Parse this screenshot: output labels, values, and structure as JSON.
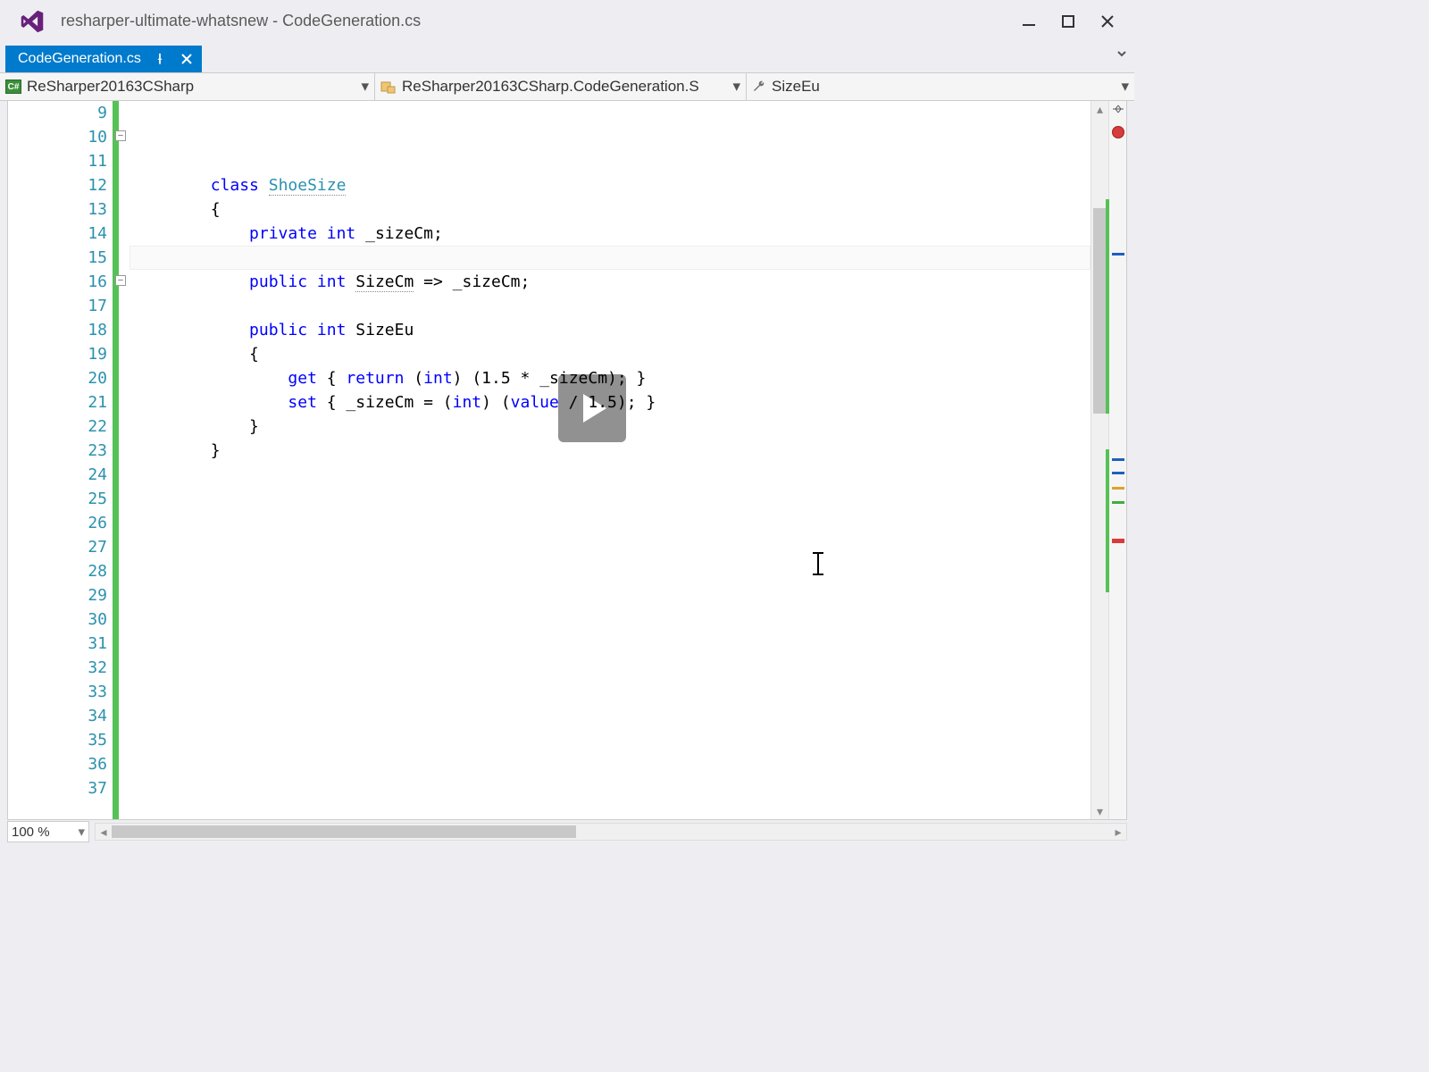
{
  "title": "resharper-ultimate-whatsnew - CodeGeneration.cs",
  "tab": {
    "label": "CodeGeneration.cs"
  },
  "nav": {
    "project": "ReSharper20163CSharp",
    "type": "ReSharper20163CSharp.CodeGeneration.S",
    "member": "SizeEu"
  },
  "zoom": "100 %",
  "gutter": {
    "start": 9,
    "end": 37
  },
  "code": {
    "l9": "",
    "l10": {
      "kw": "class",
      "name": "ShoeSize"
    },
    "l11": "        {",
    "l12": {
      "pre": "            ",
      "kw1": "private",
      "kw2": "int",
      "id": "_sizeCm",
      "post": ";"
    },
    "l13": "",
    "l14": {
      "pre": "            ",
      "kw1": "public",
      "kw2": "int",
      "id": "SizeCm",
      "arrow": " => _sizeCm;"
    },
    "l15": "",
    "l16": {
      "pre": "            ",
      "kw1": "public",
      "kw2": "int",
      "id": "SizeEu"
    },
    "l17": "            {",
    "l18": {
      "pre": "                ",
      "kw": "get",
      "open": " { ",
      "ret": "return",
      "sp": " (",
      "cast": "int",
      "rest": ") (1.5 * _sizeCm); }"
    },
    "l19": {
      "pre": "                ",
      "kw": "set",
      "open": " { _sizeCm = (",
      "cast": "int",
      "mid": ") (",
      "val": "value",
      "rest": " / 1.5); }"
    },
    "l20": "            }",
    "l21": "        }",
    "l22": "",
    "l23": "",
    "l24": "",
    "l25": "",
    "l26": "",
    "l27": "",
    "l28": "",
    "l29": "",
    "l30": "",
    "l31": "",
    "l32": "",
    "l33": "",
    "l34": "",
    "l35": "",
    "l36": "",
    "l37": ""
  },
  "icons": {
    "csharp": "C#"
  }
}
